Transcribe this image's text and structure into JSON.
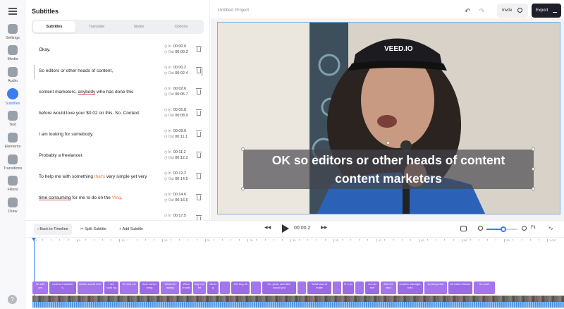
{
  "rail": {
    "items": [
      {
        "label": "Settings",
        "icon": "settings-icon"
      },
      {
        "label": "Media",
        "icon": "media-icon"
      },
      {
        "label": "Audio",
        "icon": "audio-icon"
      },
      {
        "label": "Subtitles",
        "icon": "subtitles-icon",
        "active": true
      },
      {
        "label": "Text",
        "icon": "text-icon"
      },
      {
        "label": "Elements",
        "icon": "elements-icon"
      },
      {
        "label": "Transitions",
        "icon": "transitions-icon"
      },
      {
        "label": "Filters",
        "icon": "filters-icon"
      },
      {
        "label": "Draw",
        "icon": "draw-icon"
      }
    ],
    "help": "?"
  },
  "panel": {
    "title": "Subtitles",
    "tabs": [
      "Subtitles",
      "Translate",
      "Styles",
      "Options"
    ],
    "in_label": "In",
    "out_label": "Out",
    "rows": [
      {
        "text": "Okay.",
        "in": "00:00.0",
        "out": "00:00.2"
      },
      {
        "text": "So editors or other heads of content,",
        "in": "00:00.2",
        "out": "00:02.4"
      },
      {
        "text": "content marketers, anybody who has done this",
        "in": "00:02.6",
        "out": "00:05.7"
      },
      {
        "text": "before would love your $0.02 on this. So. Context.",
        "in": "00:05.8",
        "out": "00:08.9"
      },
      {
        "text": "I am looking for somebody.",
        "in": "00:09.0",
        "out": "00:11.1"
      },
      {
        "text": "Probably a freelancer.",
        "in": "00:11.2",
        "out": "00:12.2"
      },
      {
        "text": "To help me with something that's very simple yet very",
        "in": "00:12.2",
        "out": "00:14.5"
      },
      {
        "text": "time consuming for me to do on the Vlog.",
        "in": "00:14.6",
        "out": "00:16.6"
      },
      {
        "text": "",
        "in": "00:17.5",
        "out": ""
      }
    ]
  },
  "topbar": {
    "project": "Untitled Project",
    "invite": "Invite",
    "export": "Export"
  },
  "canvas": {
    "caption_line1": "OK so editors or other heads of content",
    "caption_line2": "content marketers",
    "cap_text": "VEED.IO"
  },
  "controls": {
    "back": "Back to Timeline",
    "split": "Split Subtitle",
    "add": "Add Subtitle",
    "timecode": "00:00.2",
    "zoom_level": 0.55,
    "fit": "Fit"
  },
  "timeline": {
    "marks": [
      "0",
      "5",
      "10",
      "15",
      "20",
      "25",
      "30",
      "35",
      "40",
      "45",
      "50",
      "55",
      "1:00"
    ],
    "chips": [
      "So edit ors",
      "content marketer s,",
      "before would love",
      "I am looki ng",
      "To help me",
      "time consu ming",
      "Which is taking",
      "Woul d walk",
      "App rov ed",
      "Ma ki g",
      "",
      "Get ting all",
      "",
      "So, yeah, who like, would you",
      "",
      "What kind of make",
      "",
      "D o yo",
      "",
      "Co uld seri",
      "And I'm also",
      "content manager, but I",
      "so things like",
      "All rather fleisch",
      "So yeah"
    ]
  },
  "colors": {
    "accent": "#3b7df0",
    "chip": "#9b6ae8",
    "export_bg": "#1d1f2a"
  }
}
